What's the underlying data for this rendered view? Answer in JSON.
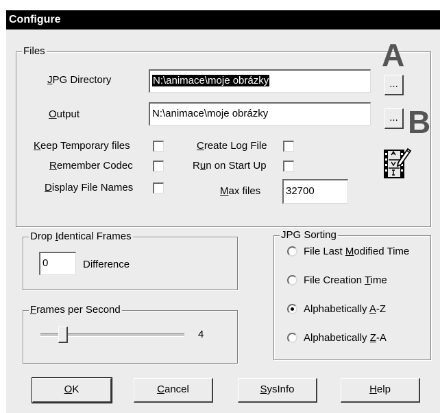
{
  "window": {
    "title": "Configure"
  },
  "files_group": {
    "title": "Files",
    "jpg_directory": {
      "label_pre": "",
      "label_u": "J",
      "label_post": "PG Directory",
      "value": "N:\\animace\\moje obrázky",
      "browse": "..."
    },
    "output": {
      "label_u": "O",
      "label_post": "utput",
      "value": "N:\\animace\\moje obrázky",
      "browse": "..."
    },
    "keep_temporary": {
      "label_u": "K",
      "label_post": "eep Temporary files",
      "checked": false
    },
    "remember_codec": {
      "label_u": "R",
      "label_post": "emember Codec",
      "checked": false
    },
    "display_file_names": {
      "label_u": "D",
      "label_post": "isplay File Names",
      "checked": false
    },
    "create_log": {
      "label_u": "C",
      "label_post": "reate Log File",
      "checked": false
    },
    "run_on_start": {
      "label_pre": "R",
      "label_u": "u",
      "label_post": "n on Start Up",
      "checked": false
    },
    "max_files": {
      "label_u": "M",
      "label_post": "ax files",
      "value": "32700"
    },
    "icon": "script-edit-icon"
  },
  "annotations": {
    "a": "A",
    "b": "B"
  },
  "drop_identical": {
    "title_pre": "Drop ",
    "title_u": "I",
    "title_post": "dentical Frames",
    "value": "0",
    "suffix": "Difference"
  },
  "fps": {
    "title_u": "F",
    "title_post": "rames per Second",
    "value": "4",
    "level": 0.25
  },
  "jpg_sorting": {
    "title": "JPG Sorting",
    "options": [
      {
        "pre": "File Last ",
        "u": "M",
        "post": "odified Time",
        "selected": false
      },
      {
        "pre": "File Creation ",
        "u": "T",
        "post": "ime",
        "selected": false
      },
      {
        "pre": "Alphabetically ",
        "u": "A",
        "post": "-Z",
        "selected": true
      },
      {
        "pre": "Alphabetically ",
        "u": "Z",
        "post": "-A",
        "selected": false
      }
    ]
  },
  "buttons": {
    "ok": {
      "u": "O",
      "post": "K"
    },
    "cancel": {
      "u": "C",
      "post": "ancel"
    },
    "sysinfo": {
      "u": "S",
      "post": "ysInfo"
    },
    "help": {
      "u": "H",
      "post": "elp"
    }
  }
}
